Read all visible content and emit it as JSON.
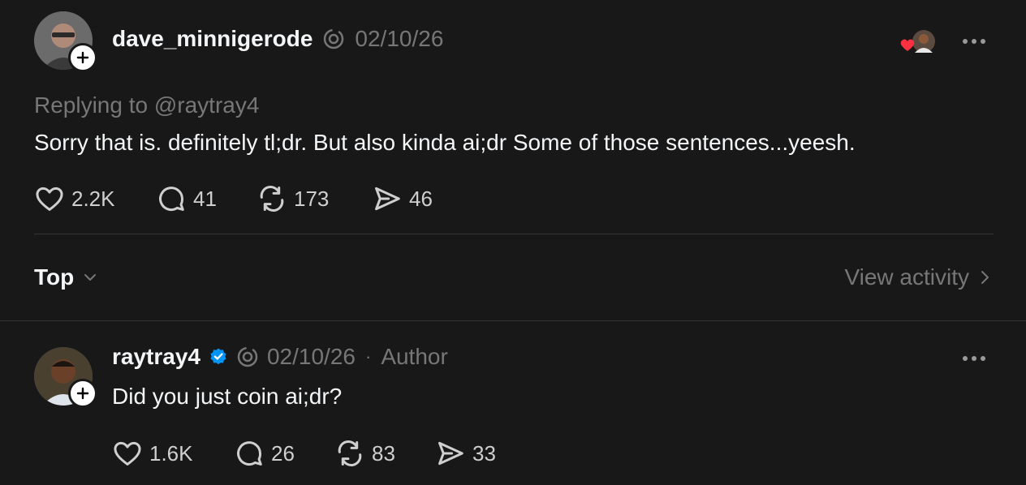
{
  "post": {
    "username": "dave_minnigerode",
    "date": "02/10/26",
    "replying_to": "Replying to @raytray4",
    "text": "Sorry that is. definitely tl;dr. But also kinda ai;dr Some of those sentences...yeesh.",
    "likes": "2.2K",
    "comments": "41",
    "reposts": "173",
    "shares": "46"
  },
  "sort": {
    "label": "Top",
    "view_activity": "View activity"
  },
  "reply": {
    "username": "raytray4",
    "date": "02/10/26",
    "separator": "·",
    "author_label": "Author",
    "text": "Did you just coin ai;dr?",
    "likes": "1.6K",
    "comments": "26",
    "reposts": "83",
    "shares": "33"
  },
  "colors": {
    "background": "#181818",
    "verified": "#0095f6",
    "heart": "#ff3040",
    "muted": "#777777"
  },
  "icons": [
    "plus-icon",
    "threads-icon",
    "verified-icon",
    "heart-icon",
    "comment-icon",
    "repost-icon",
    "share-icon",
    "more-icon",
    "chevron-down-icon",
    "chevron-right-icon"
  ]
}
